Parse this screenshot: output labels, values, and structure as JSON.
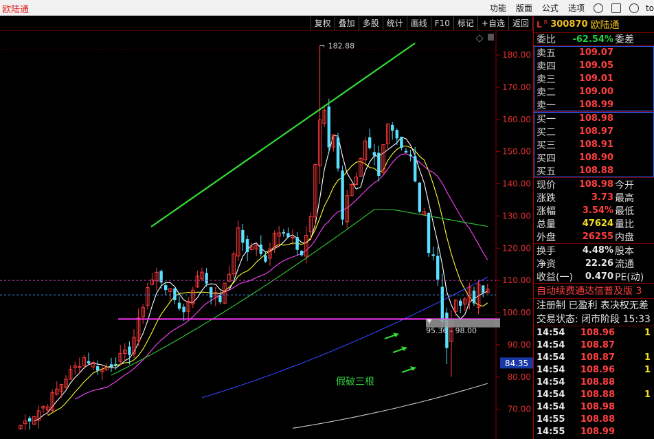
{
  "app": {
    "title": "欧陆通"
  },
  "top_menu": {
    "items": [
      "功能",
      "版面",
      "公式",
      "选项"
    ],
    "icons": [
      "refresh-icon",
      "shirt-icon",
      "minimize-icon"
    ],
    "tail": "to"
  },
  "toolbar": {
    "buttons": [
      "复权",
      "叠加",
      "多股",
      "统计",
      "画线",
      "F10",
      "标记",
      "+自选",
      "返回"
    ]
  },
  "chart_data": {
    "type": "candlestick",
    "y_ticks": [
      "180.00",
      "170.00",
      "160.00",
      "150.00",
      "140.00",
      "130.00",
      "120.00",
      "110.00",
      "100.00",
      "90.00",
      "80.00",
      "70.00"
    ],
    "ylim": [
      64,
      186
    ],
    "annotations": {
      "high_label": "182.88",
      "range_label": "95.36 - 98.00",
      "note": "假破三根",
      "price_tag": "84.35"
    },
    "colors": {
      "up": "#ff3b3b",
      "down": "#5ae0ff",
      "trendline": "#33e033",
      "support": "#ff33ff",
      "ma5": "#ffffff",
      "ma10": "#ffff33",
      "ma20": "#ff44ff",
      "ma60": "#33cc33",
      "ma120": "#3344ff",
      "ma250": "#cccccc"
    }
  },
  "panel": {
    "header": {
      "flag": "L",
      "sup": "R",
      "code": "300870",
      "name": "欧陆通"
    },
    "weibi": {
      "label": "委比",
      "value": "-62.54%",
      "label2": "委差"
    },
    "asks": [
      {
        "label": "卖五",
        "price": "109.07"
      },
      {
        "label": "卖四",
        "price": "109.05"
      },
      {
        "label": "卖三",
        "price": "109.01"
      },
      {
        "label": "卖二",
        "price": "109.00"
      },
      {
        "label": "卖一",
        "price": "108.99"
      }
    ],
    "bids": [
      {
        "label": "买一",
        "price": "108.98"
      },
      {
        "label": "买二",
        "price": "108.97"
      },
      {
        "label": "买三",
        "price": "108.91"
      },
      {
        "label": "买四",
        "price": "108.90"
      },
      {
        "label": "买五",
        "price": "108.88"
      }
    ],
    "quote": [
      {
        "label": "现价",
        "value": "108.98",
        "label2": "今开",
        "color": "red"
      },
      {
        "label": "涨跌",
        "value": "3.73",
        "label2": "最高",
        "color": "red"
      },
      {
        "label": "涨幅",
        "value": "3.54%",
        "label2": "最低",
        "color": "red"
      },
      {
        "label": "总量",
        "value": "47624",
        "label2": "量比",
        "color": "yellow"
      },
      {
        "label": "外盘",
        "value": "26255",
        "label2": "内盘",
        "color": "red"
      }
    ],
    "stats": [
      {
        "label": "换手",
        "value": "4.48%",
        "label2": "股本"
      },
      {
        "label": "净资",
        "value": "22.26",
        "label2": "流通"
      },
      {
        "label": "收益(一)",
        "value": "0.470",
        "label2": "PE(动)"
      }
    ],
    "marquee": "自动续费通达信普及版 3",
    "note1": "注册制 已盈利 表决权无差",
    "note2": "交易状态: 闭市阶段 15:33",
    "ticks": [
      {
        "time": "14:54",
        "price": "108.96",
        "vol": "1"
      },
      {
        "time": "14:54",
        "price": "108.87",
        "vol": ""
      },
      {
        "time": "14:54",
        "price": "108.87",
        "vol": "1"
      },
      {
        "time": "14:54",
        "price": "108.96",
        "vol": "1"
      },
      {
        "time": "14:54",
        "price": "108.88",
        "vol": ""
      },
      {
        "time": "14:54",
        "price": "108.88",
        "vol": "1"
      },
      {
        "time": "14:54",
        "price": "108.98",
        "vol": ""
      },
      {
        "time": "14:55",
        "price": "108.88",
        "vol": ""
      },
      {
        "time": "14:55",
        "price": "108.99",
        "vol": ""
      }
    ]
  }
}
